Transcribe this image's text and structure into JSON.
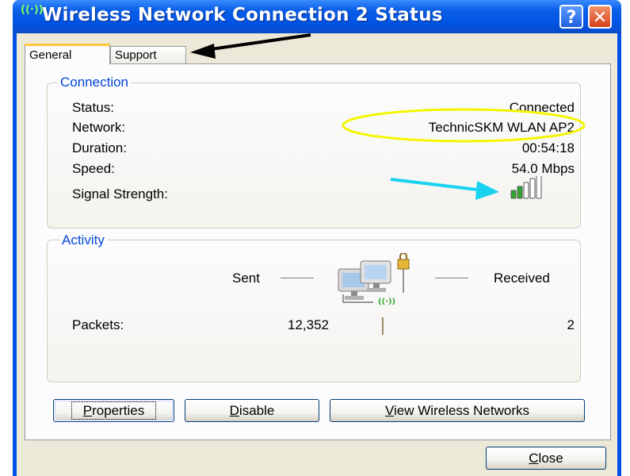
{
  "window": {
    "title": "Wireless Network Connection 2 Status",
    "title_icon": "wireless-icon",
    "help_label": "?",
    "close_label": "✕"
  },
  "tabs": [
    {
      "label": "General",
      "selected": true
    },
    {
      "label": "Support",
      "selected": false
    }
  ],
  "connection": {
    "legend": "Connection",
    "status_label": "Status:",
    "status_value": "Connected",
    "network_label": "Network:",
    "network_value": "TechnicSKM WLAN AP2",
    "duration_label": "Duration:",
    "duration_value": "00:54:18",
    "speed_label": "Speed:",
    "speed_value": "54.0 Mbps",
    "signal_label": "Signal Strength:",
    "signal_bars_active": 2,
    "signal_bars_total": 5
  },
  "activity": {
    "legend": "Activity",
    "sent_label": "Sent",
    "received_label": "Received",
    "packets_label": "Packets:",
    "packets_sent": "12,352",
    "packets_received": "2",
    "icon": "network-computers-icon"
  },
  "buttons": {
    "properties": {
      "pre": "",
      "accel": "P",
      "post": "roperties"
    },
    "disable": {
      "pre": "",
      "accel": "D",
      "post": "isable"
    },
    "view_networks": {
      "pre": "",
      "accel": "V",
      "post": "iew Wireless Networks"
    },
    "close": {
      "pre": "",
      "accel": "C",
      "post": "lose"
    }
  },
  "colors": {
    "title_bar": "#0054e3",
    "group_legend": "#0046d5",
    "annotation_highlight": "#f5f500",
    "annotation_arrow_cyan": "#19d3f0",
    "annotation_arrow_black": "#000000",
    "signal_active": "#2fa82f"
  }
}
